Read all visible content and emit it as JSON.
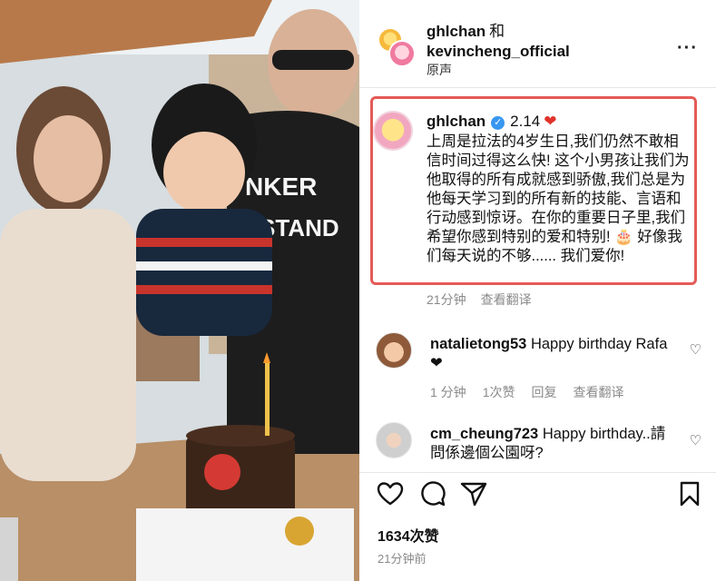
{
  "header": {
    "user1": "ghlchan",
    "conjunction": "和",
    "user2": "kevincheng_official",
    "audio": "原声",
    "more": "···"
  },
  "caption": {
    "username": "ghlchan",
    "verified": "✓",
    "date": "2.14",
    "heart": "❤",
    "text": "上周是拉法的4岁生日,我们仍然不敢相信时间过得这么快! 这个小男孩让我们为他取得的所有成就感到骄傲,我们总是为他每天学习到的所有新的技能、言语和行动感到惊讶。在你的重要日子里,我们希望你感到特别的爱和特别! 🎂 好像我们每天说的不够...... 我们爱你!",
    "time": "21分钟",
    "view_translation": "查看翻译"
  },
  "comments": [
    {
      "username": "natalietong53",
      "text": "Happy birthday Rafa❤",
      "time": "1 分钟",
      "likes": "1次赞",
      "reply": "回复",
      "view_translation": "查看翻译"
    },
    {
      "username": "cm_cheung723",
      "text": "Happy birthday..請問係邊個公園呀?"
    }
  ],
  "actions": {
    "like_icon": "heart-outline-icon",
    "comment_icon": "comment-icon",
    "share_icon": "paper-plane-icon",
    "save_icon": "bookmark-icon"
  },
  "likes_count": "1634次赞",
  "posted_ago": "21分钟前",
  "colors": {
    "highlight_border": "#e45b57",
    "verified": "#3897f0",
    "meta_text": "#8a8a8a"
  }
}
